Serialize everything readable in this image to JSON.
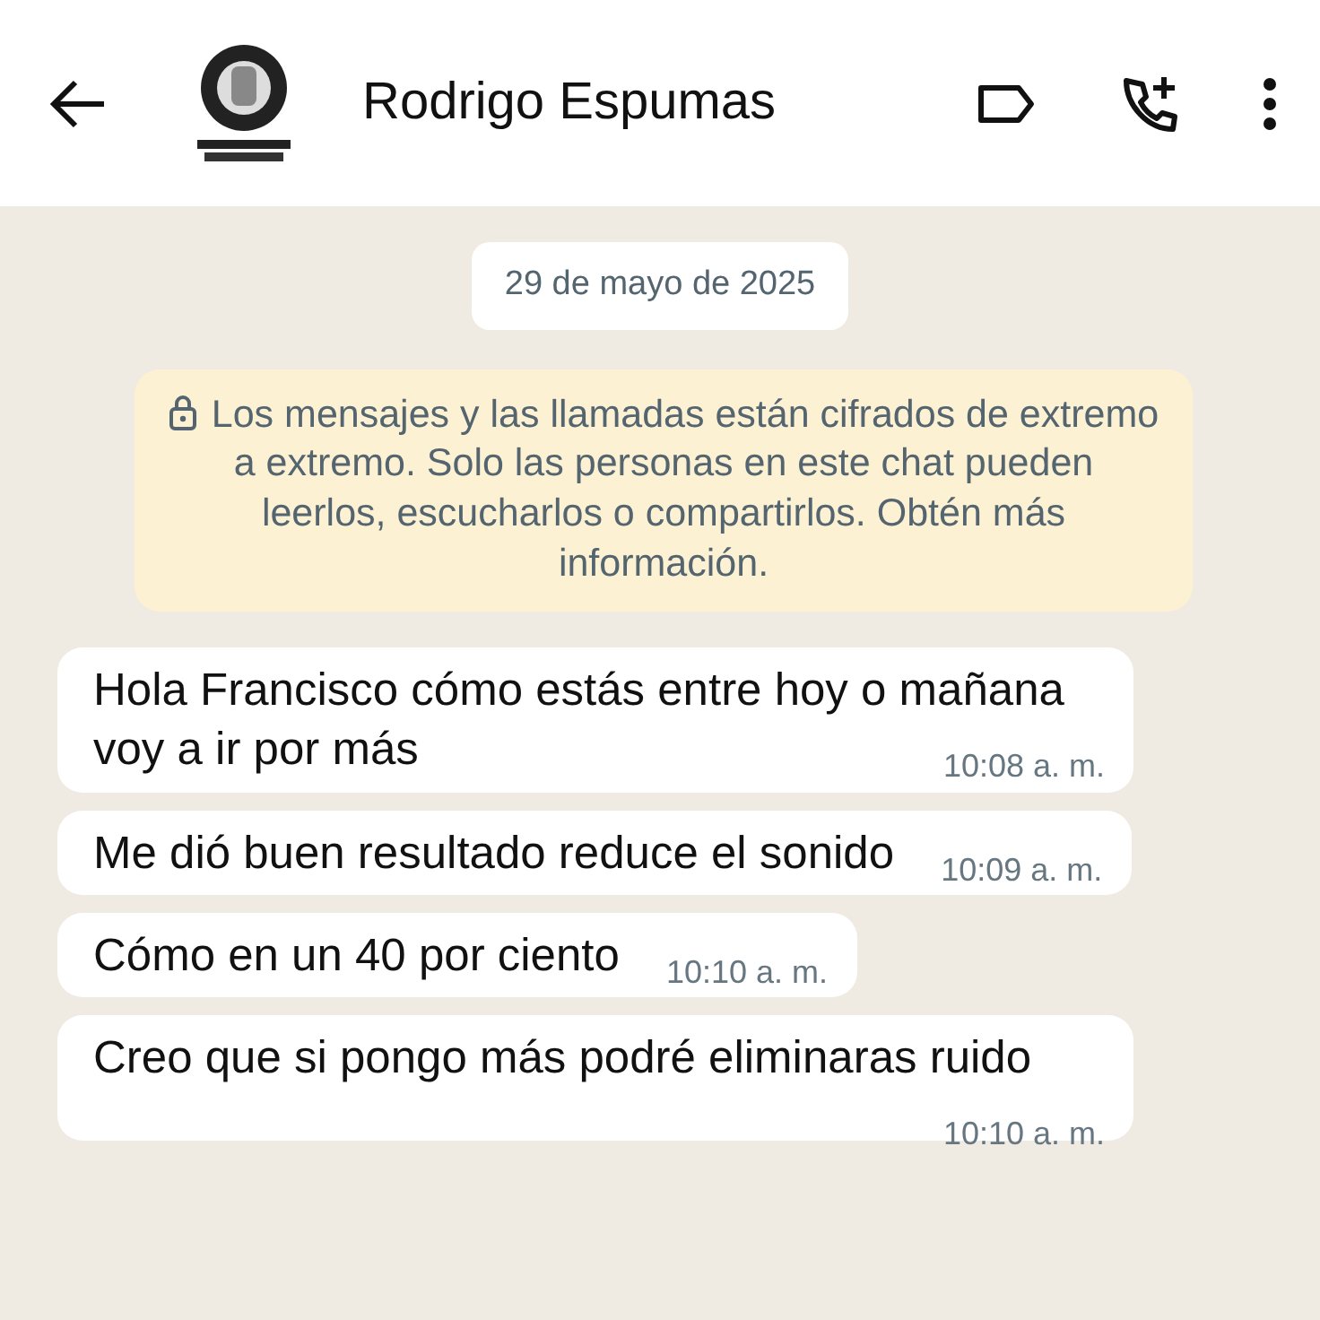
{
  "header": {
    "title": "Rodrigo Espumas"
  },
  "date_chip": "29 de mayo de 2025",
  "encryption_notice": "Los mensajes y las llamadas están cifrados de extremo a extremo. Solo las personas en este chat pueden leerlos, escucharlos o compartirlos. Obtén más información.",
  "messages": [
    {
      "text": "Hola Francisco cómo estás entre hoy o mañana voy a ir por más",
      "time": "10:08 a. m."
    },
    {
      "text": "Me dió buen resultado reduce el sonido",
      "time": "10:09 a. m."
    },
    {
      "text": "Cómo en un 40  por ciento",
      "time": "10:10 a. m."
    },
    {
      "text": "Creo que si pongo más podré eliminaras ruido",
      "time": "10:10 a. m."
    }
  ]
}
